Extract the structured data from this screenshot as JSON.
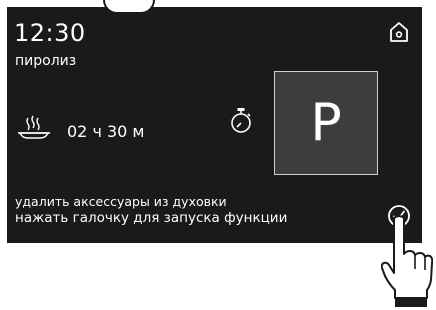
{
  "status": {
    "time": "12:30",
    "mode": "пиролиз"
  },
  "cooking": {
    "duration": "02 ч 30 м"
  },
  "program": {
    "letter": "P"
  },
  "message": {
    "line1": "удалить аксессуары из духовки",
    "line2": "нажать галочку для запуска функции"
  },
  "icons": {
    "home": "home-icon",
    "dish": "dish-icon",
    "timer": "timer-icon",
    "confirm": "checkmark-icon",
    "hand": "hand-pointer-icon"
  },
  "colors": {
    "screen": "#1a1a1a",
    "tile": "#3d3d3d",
    "text": "#ffffff"
  }
}
